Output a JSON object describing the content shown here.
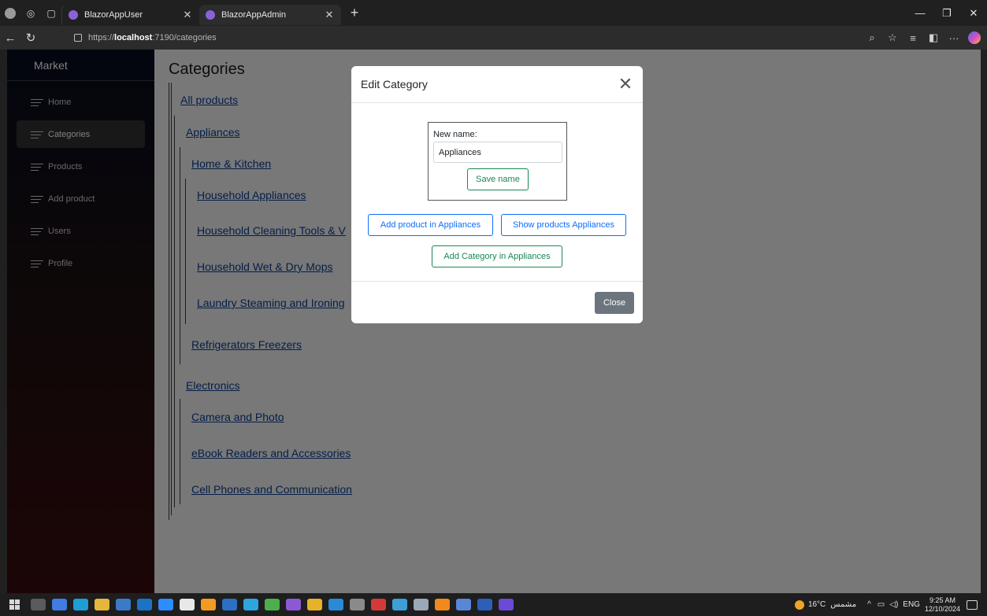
{
  "browser": {
    "tabs": [
      {
        "label": "BlazorAppUser",
        "active": false
      },
      {
        "label": "BlazorAppAdmin",
        "active": true
      }
    ],
    "url_scheme": "https://",
    "url_host": "localhost",
    "url_path": ":7190/categories"
  },
  "sidebar": {
    "brand": "Market",
    "items": [
      {
        "label": "Home"
      },
      {
        "label": "Categories",
        "active": true
      },
      {
        "label": "Products"
      },
      {
        "label": "Add product"
      },
      {
        "label": "Users"
      },
      {
        "label": "Profile"
      }
    ]
  },
  "page": {
    "title": "Categories",
    "tree": {
      "root": "All products",
      "appliances": "Appliances",
      "home_kitchen": "Home & Kitchen",
      "household_appliances": "Household Appliances",
      "household_cleaning": "Household Cleaning Tools & V",
      "wet_dry_mops": "Household Wet & Dry Mops",
      "laundry": "Laundry Steaming and Ironing",
      "refrigerators": "Refrigerators Freezers",
      "electronics": "Electronics",
      "camera": "Camera and Photo",
      "ebook": "eBook Readers and Accessories",
      "cell_phones": "Cell Phones and Communication"
    }
  },
  "modal": {
    "title": "Edit Category",
    "close_glyph": "✕",
    "name_label": "New name:",
    "name_value": "Appliances",
    "save_label": "Save name",
    "add_product_label": "Add product in Appliances",
    "show_products_label": "Show products Appliances",
    "add_category_label": "Add Category in Appliances",
    "footer_close_label": "Close"
  },
  "taskbar": {
    "weather": "16°C",
    "weather_text": "مشمس",
    "lang": "ENG",
    "time": "9:25 AM",
    "date": "12/10/2024"
  }
}
